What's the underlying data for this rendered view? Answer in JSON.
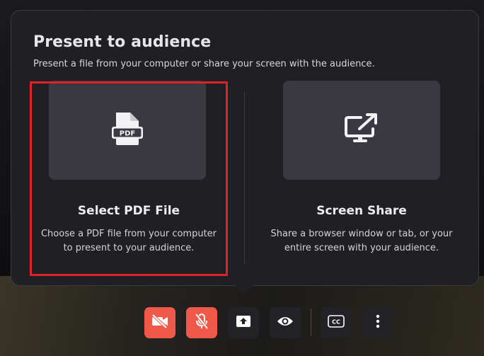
{
  "dialog": {
    "title": "Present to audience",
    "subtitle": "Present a file from your computer or share your screen with the audience."
  },
  "options": [
    {
      "title": "Select PDF File",
      "description_line1": "Choose a PDF file from your computer",
      "description_line2": "to present to your audience.",
      "icon": "pdf-file-icon",
      "icon_text": "PDF",
      "highlighted": true
    },
    {
      "title": "Screen Share",
      "description_line1": "Share a browser window or tab, or your",
      "description_line2": "entire screen with your audience.",
      "icon": "screen-share-icon",
      "highlighted": false
    }
  ],
  "toolbar": {
    "buttons": [
      {
        "icon": "camera-off-icon",
        "state": "off"
      },
      {
        "icon": "mic-off-icon",
        "state": "off"
      },
      {
        "icon": "present-upload-icon",
        "state": "active"
      },
      {
        "icon": "eye-icon",
        "state": "normal"
      },
      {
        "icon": "closed-captions-icon",
        "label": "CC",
        "state": "normal"
      },
      {
        "icon": "more-options-icon",
        "state": "normal"
      }
    ]
  },
  "colors": {
    "panel_bg": "#1f1f24",
    "tile_bg": "#3a3942",
    "highlight_border": "#e0202a",
    "toolbar_off": "#f0584a",
    "toolbar_normal": "#232327"
  }
}
